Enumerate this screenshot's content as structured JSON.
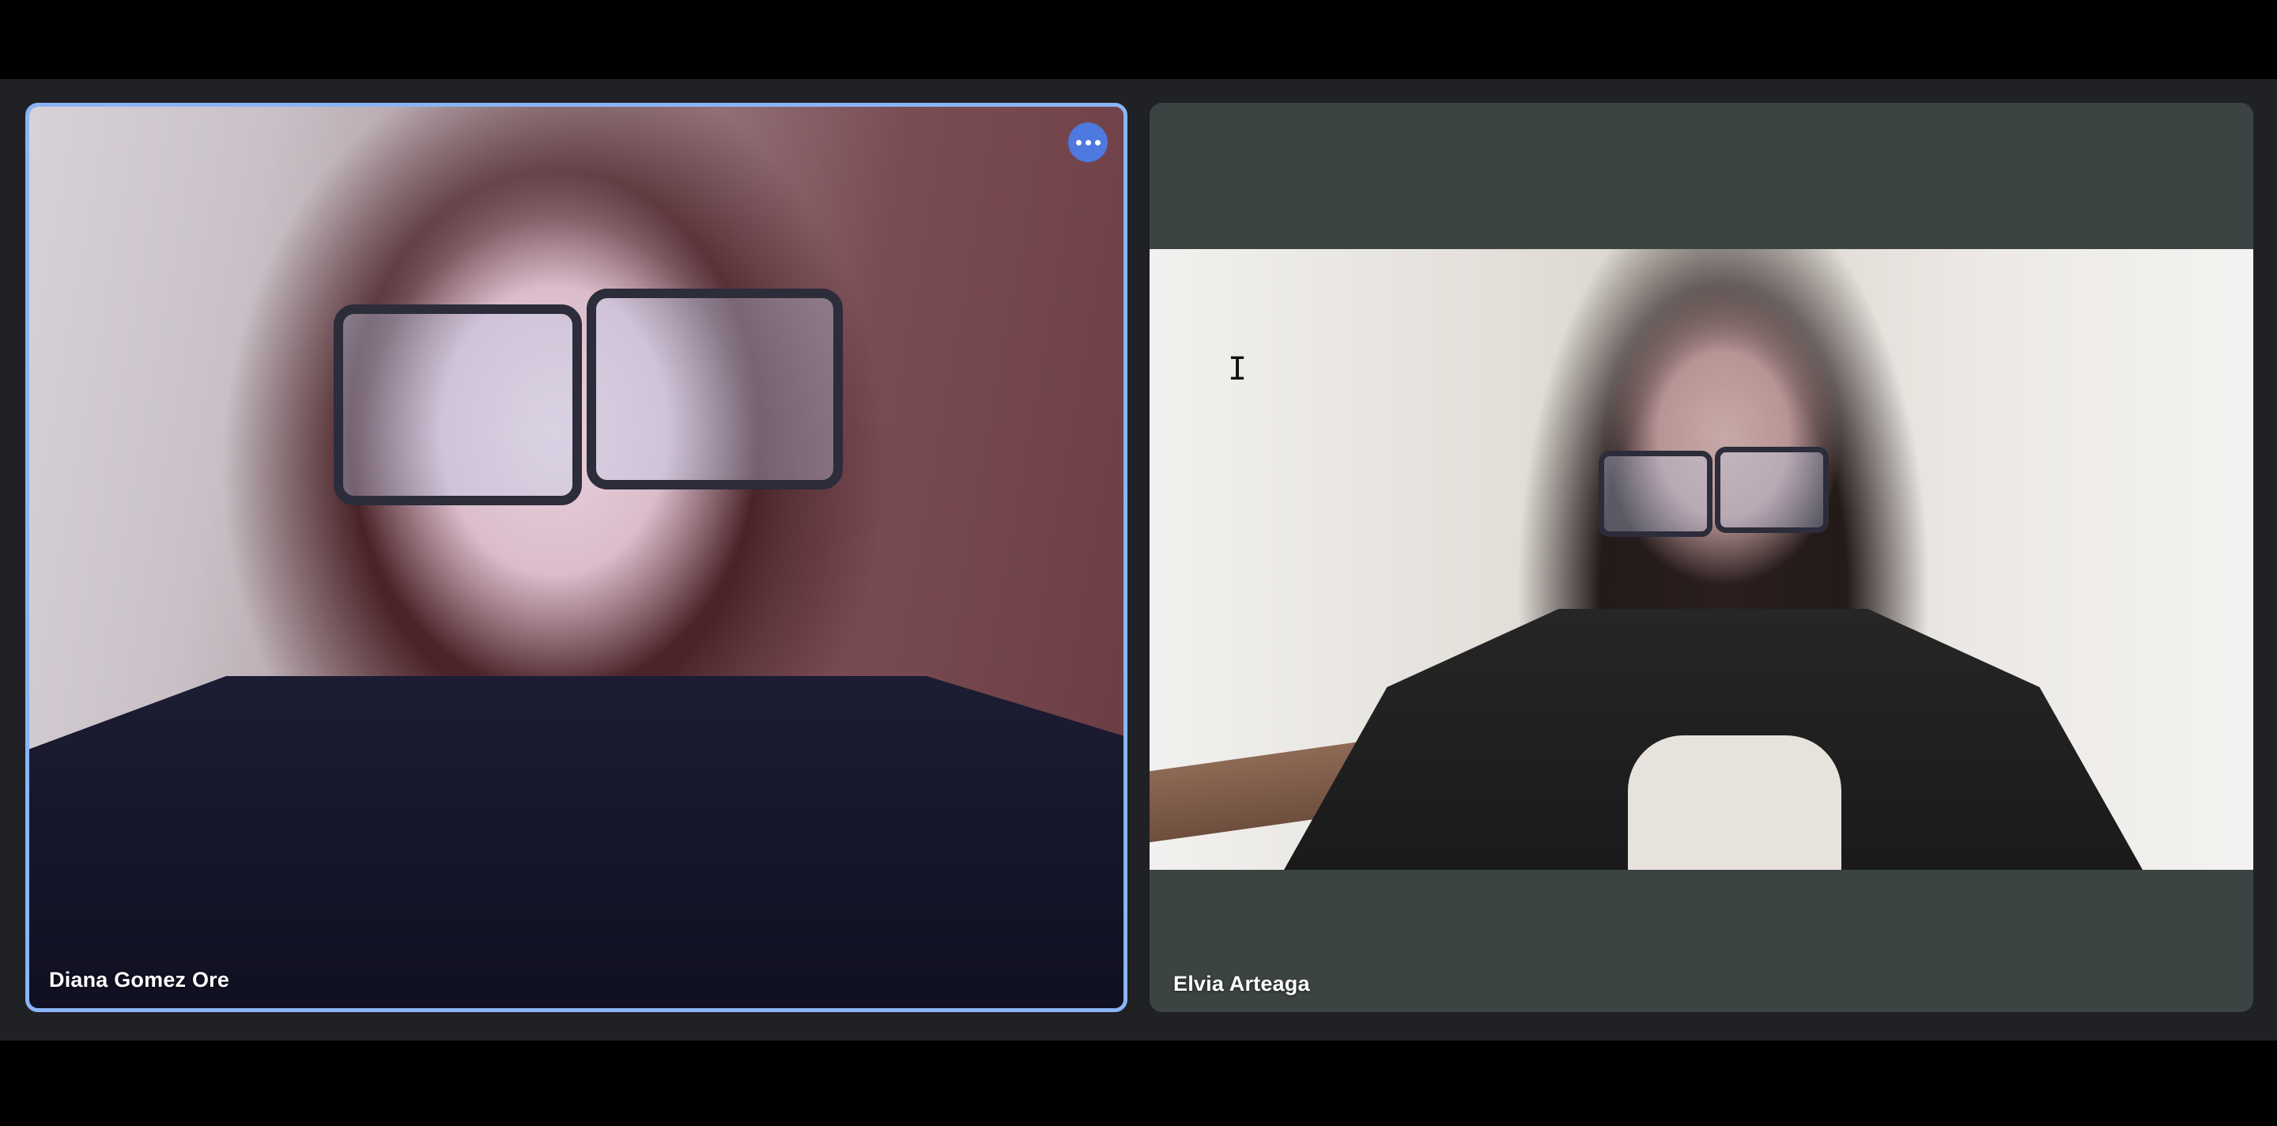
{
  "meeting": {
    "participants": [
      {
        "name": "Diana Gomez Ore",
        "active_speaker": true,
        "more_options_icon": "more-horizontal-icon",
        "accent_color": "#8ab4f8"
      },
      {
        "name": "Elvia Arteaga",
        "active_speaker": false
      }
    ],
    "cursor_icon": "text-cursor-icon",
    "cursor_glyph": "I"
  }
}
